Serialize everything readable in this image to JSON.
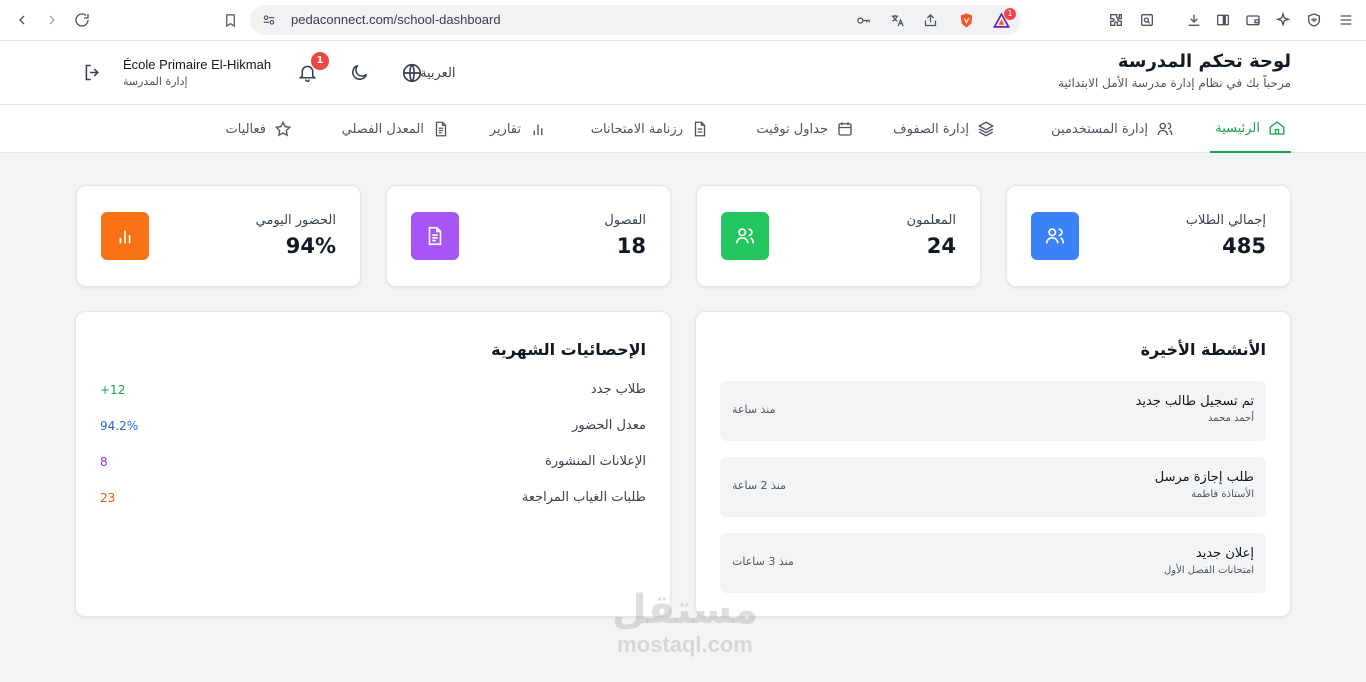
{
  "browser": {
    "url": "pedaconnect.com/school-dashboard",
    "extension_badge": "1"
  },
  "header": {
    "title": "لوحة تحكم المدرسة",
    "subtitle": "مرحباً بك في نظام إدارة مدرسة الأمل الابتدائية",
    "language": "العربية",
    "notification_count": "1",
    "school_name": "École Primaire El-Hikmah",
    "role": "إدارة المدرسة"
  },
  "nav": {
    "items": [
      {
        "label": "الرئيسية",
        "icon": "home-icon",
        "active": true
      },
      {
        "label": "إدارة المستخدمين",
        "icon": "users-icon"
      },
      {
        "label": "إدارة الصفوف",
        "icon": "layers-icon"
      },
      {
        "label": "جداول توقيت",
        "icon": "calendar-icon"
      },
      {
        "label": "رزنامة الامتحانات",
        "icon": "file-icon"
      },
      {
        "label": "تقارير",
        "icon": "bar-chart-icon"
      },
      {
        "label": "المعدل الفصلي",
        "icon": "file-text-icon"
      },
      {
        "label": "فعاليات",
        "icon": "star-icon"
      }
    ]
  },
  "stats": [
    {
      "label": "إجمالي الطلاب",
      "value": "485",
      "icon": "users-icon",
      "color": "#3b82f6"
    },
    {
      "label": "المعلمون",
      "value": "24",
      "icon": "users-icon",
      "color": "#22c55e"
    },
    {
      "label": "الفصول",
      "value": "18",
      "icon": "file-text-icon",
      "color": "#a855f7"
    },
    {
      "label": "الحضور اليومي",
      "value": "94%",
      "icon": "bar-chart-icon",
      "color": "#f97316"
    }
  ],
  "activities": {
    "title": "الأنشطة الأخيرة",
    "items": [
      {
        "title": "تم تسجيل طالب جديد",
        "subtitle": "أحمد محمد",
        "time": "منذ ساعة"
      },
      {
        "title": "طلب إجازة مرسل",
        "subtitle": "الأستاذة فاطمة",
        "time": "منذ 2 ساعة"
      },
      {
        "title": "إعلان جديد",
        "subtitle": "امتحانات الفصل الأول",
        "time": "منذ 3 ساعات"
      }
    ]
  },
  "monthly": {
    "title": "الإحصائيات الشهرية",
    "rows": [
      {
        "label": "طلاب جدد",
        "value": "+12",
        "color": "#16a34a"
      },
      {
        "label": "معدل الحضور",
        "value": "94.2%",
        "color": "#2563eb"
      },
      {
        "label": "الإعلانات المنشورة",
        "value": "8",
        "color": "#9333ea"
      },
      {
        "label": "طلبات الغياب المراجعة",
        "value": "23",
        "color": "#ea580c"
      }
    ]
  },
  "watermark": {
    "arabic": "مستقل",
    "latin": "mostaql.com"
  }
}
